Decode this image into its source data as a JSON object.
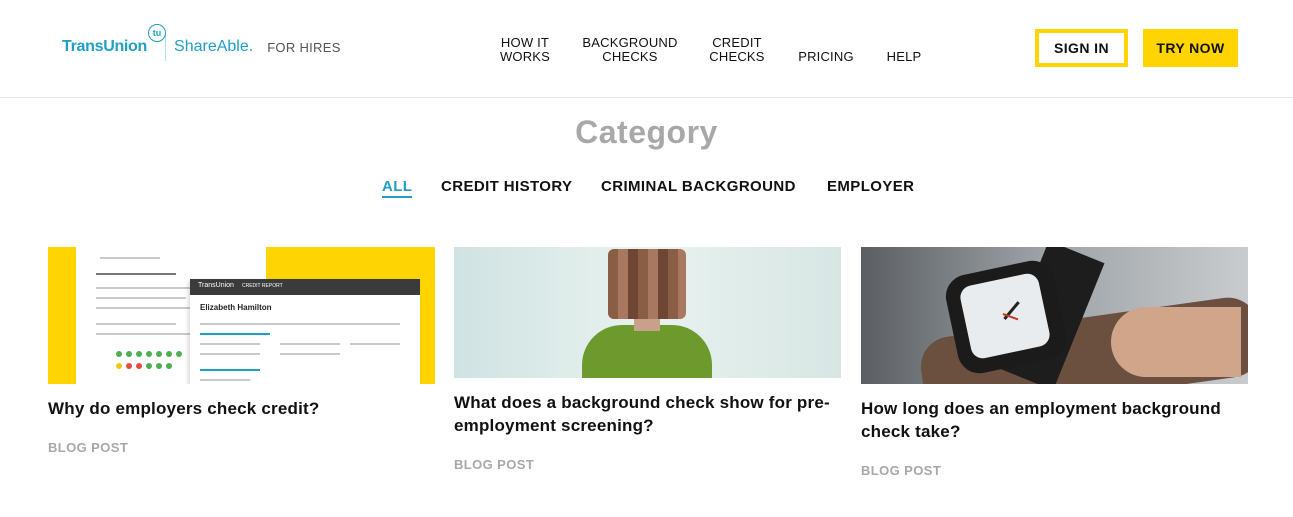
{
  "header": {
    "logo_brand": "TransUnion",
    "logo_badge": "tu",
    "logo_product": "ShareAble.",
    "logo_audience": "FOR HIRES",
    "nav": [
      {
        "line1": "HOW IT",
        "line2": "WORKS"
      },
      {
        "line1": "BACKGROUND",
        "line2": "CHECKS"
      },
      {
        "line1": "CREDIT",
        "line2": "CHECKS"
      },
      {
        "line1": "",
        "line2": "PRICING"
      },
      {
        "line1": "",
        "line2": "HELP"
      }
    ],
    "sign_in_label": "SIGN IN",
    "try_now_label": "TRY NOW",
    "accent_color": "#ffd400",
    "brand_color": "#1f9fc4"
  },
  "category": {
    "title": "Category",
    "tabs": [
      {
        "label": "ALL",
        "active": true
      },
      {
        "label": "CREDIT HISTORY",
        "active": false
      },
      {
        "label": "CRIMINAL BACKGROUND",
        "active": false
      },
      {
        "label": "EMPLOYER",
        "active": false
      }
    ]
  },
  "cards": [
    {
      "title": "Why do employers check credit?",
      "type": "BLOG POST",
      "image": "credit-report-image"
    },
    {
      "title": "What does a background check show for pre-employment screening?",
      "type": "BLOG POST",
      "image": "woman-portrait-image"
    },
    {
      "title": "How long does an employment background check take?",
      "type": "BLOG POST",
      "image": "wristwatch-image"
    }
  ],
  "card_images": {
    "credit_report": {
      "report_brand": "TransUnion",
      "report_title": "CREDIT REPORT",
      "subject_name": "Elizabeth Hamilton"
    }
  }
}
